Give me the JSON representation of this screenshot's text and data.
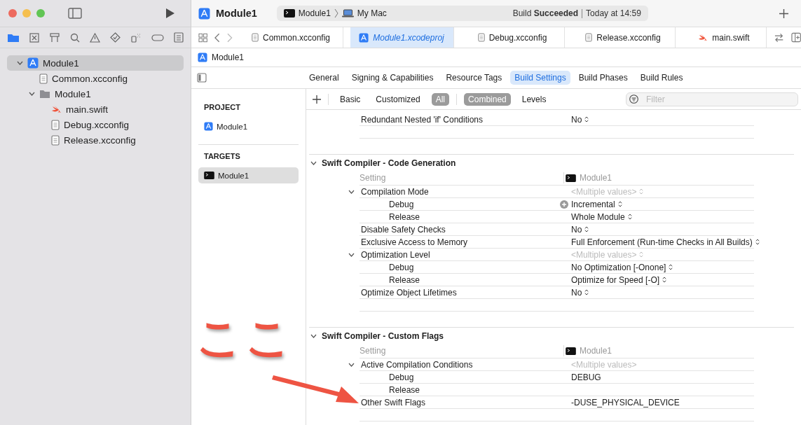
{
  "window": {
    "title": "Module1",
    "scheme": "Module1",
    "destination": "My Mac",
    "status": "Build **Succeeded**",
    "status_time": "Today at 14:59"
  },
  "navigator": {
    "tree": [
      {
        "label": "Module1",
        "kind": "project",
        "selected": true,
        "expanded": true,
        "children": [
          {
            "label": "Common.xcconfig",
            "kind": "file",
            "selected": false
          },
          {
            "label": "Module1",
            "kind": "folder",
            "selected": false,
            "expanded": true,
            "children": [
              {
                "label": "main.swift",
                "kind": "swift",
                "selected": false
              },
              {
                "label": "Debug.xcconfig",
                "kind": "file",
                "selected": false
              },
              {
                "label": "Release.xcconfig",
                "kind": "file",
                "selected": false
              }
            ]
          }
        ]
      }
    ]
  },
  "editor_tabs": [
    {
      "label": "Common.xcconfig",
      "kind": "file",
      "selected": false
    },
    {
      "label": "Module1.xcodeproj",
      "kind": "project",
      "selected": true
    },
    {
      "label": "Debug.xcconfig",
      "kind": "file",
      "selected": false
    },
    {
      "label": "Release.xcconfig",
      "kind": "file",
      "selected": false
    },
    {
      "label": "main.swift",
      "kind": "swift",
      "selected": false
    }
  ],
  "jump_bar": "Module1",
  "target_tabs": [
    {
      "label": "General",
      "selected": false
    },
    {
      "label": "Signing & Capabilities",
      "selected": false
    },
    {
      "label": "Resource Tags",
      "selected": false
    },
    {
      "label": "Build Settings",
      "selected": true
    },
    {
      "label": "Build Phases",
      "selected": false
    },
    {
      "label": "Build Rules",
      "selected": false
    }
  ],
  "filter_groups": [
    [
      {
        "label": "Basic",
        "selected": false
      },
      {
        "label": "Customized",
        "selected": false
      },
      {
        "label": "All",
        "selected": true
      }
    ],
    [
      {
        "label": "Combined",
        "selected": true
      },
      {
        "label": "Levels",
        "selected": false
      }
    ]
  ],
  "filter": {
    "placeholder": "Filter"
  },
  "targets_list": [
    {
      "heading": "PROJECT",
      "items": [
        {
          "label": "Module1",
          "kind": "project",
          "selected": false
        }
      ]
    },
    {
      "heading": "TARGETS",
      "items": [
        {
          "label": "Module1",
          "kind": "target",
          "selected": true
        }
      ]
    }
  ],
  "sections": [
    {
      "rows": [
        {
          "name": "Redundant Nested 'if' Conditions",
          "value": "No",
          "popup": true,
          "muted": false,
          "added": false
        }
      ]
    },
    {
      "title": "Swift Compiler - Code Generation",
      "header": {
        "setting": "Setting",
        "target": "Module1"
      },
      "rows": [
        {
          "name": "Compilation Mode",
          "value": "<Multiple values>",
          "popup": true,
          "muted": true,
          "added": false,
          "expanded": true,
          "children": [
            {
              "name": "Debug",
              "value": "Incremental",
              "popup": true,
              "muted": false,
              "added": true
            },
            {
              "name": "Release",
              "value": "Whole Module",
              "popup": true,
              "muted": false,
              "added": false
            }
          ]
        },
        {
          "name": "Disable Safety Checks",
          "value": "No",
          "popup": true,
          "muted": false,
          "added": false
        },
        {
          "name": "Exclusive Access to Memory",
          "value": "Full Enforcement (Run-time Checks in All Builds)",
          "popup": true,
          "muted": false,
          "added": false
        },
        {
          "name": "Optimization Level",
          "value": "<Multiple values>",
          "popup": true,
          "muted": true,
          "added": false,
          "expanded": true,
          "children": [
            {
              "name": "Debug",
              "value": "No Optimization [-Onone]",
              "popup": true,
              "muted": false,
              "added": false
            },
            {
              "name": "Release",
              "value": "Optimize for Speed [-O]",
              "popup": true,
              "muted": false,
              "added": false
            }
          ]
        },
        {
          "name": "Optimize Object Lifetimes",
          "value": "No",
          "popup": true,
          "muted": false,
          "added": false
        }
      ]
    },
    {
      "title": "Swift Compiler - Custom Flags",
      "header": {
        "setting": "Setting",
        "target": "Module1"
      },
      "rows": [
        {
          "name": "Active Compilation Conditions",
          "value": "<Multiple values>",
          "popup": false,
          "muted": true,
          "added": false,
          "expanded": true,
          "children": [
            {
              "name": "Debug",
              "value": "DEBUG",
              "popup": false,
              "muted": false,
              "added": false
            },
            {
              "name": "Release",
              "popup": false,
              "added": false
            }
          ]
        },
        {
          "name": "Other Swift Flags",
          "value": "-DUSE_PHYSICAL_DEVICE",
          "popup": false,
          "muted": false,
          "added": false
        }
      ]
    }
  ],
  "annotation": {
    "text": "ここ"
  }
}
